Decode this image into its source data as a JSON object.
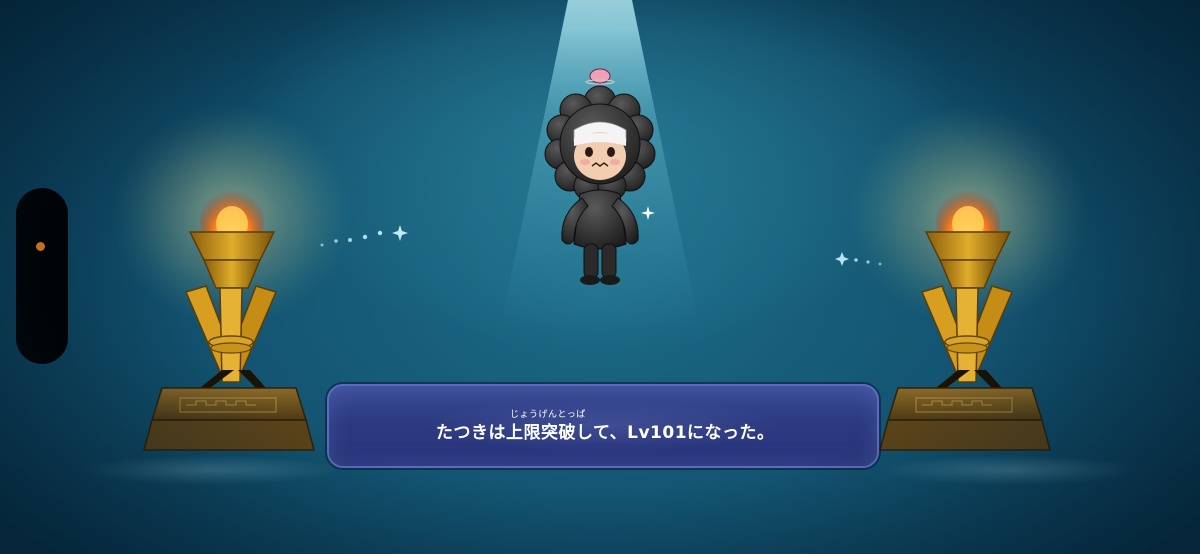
{
  "dialog": {
    "ruby": "じょうげんとっぱ",
    "message": "たつきは上限突破して、Lv101になった。"
  },
  "colors": {
    "background_deep": "#0b3b52",
    "dialog_fill": "#2c3a80",
    "dialog_border": "#5b6db8",
    "status_dot": "#ff8a1e",
    "flame": "#ff7a1a",
    "torch_gold": "#c8911c"
  },
  "icons": {
    "status_dot": "orange-dot-icon",
    "torch": "torch-icon",
    "character": "character-figure",
    "sparkle": "sparkle-icon"
  }
}
